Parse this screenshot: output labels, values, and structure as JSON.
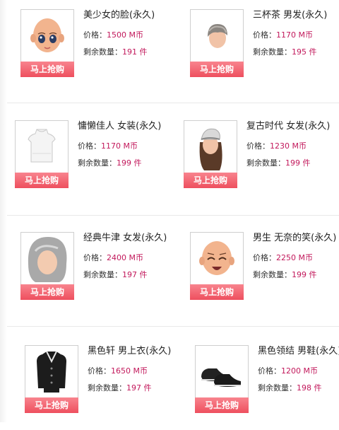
{
  "labels": {
    "price": "价格：",
    "stock": "剩余数量：",
    "buy_button": "马上抢购"
  },
  "items": [
    {
      "name": "美少女的脸(永久)",
      "price": "1500 M币",
      "stock": "191 件",
      "icon": "girl-face-icon"
    },
    {
      "name": "三杯茶 男发(永久)",
      "price": "1170 M币",
      "stock": "195 件",
      "icon": "male-hair-icon"
    },
    {
      "name": "慵懒佳人 女装(永久)",
      "price": "1170 M币",
      "stock": "199 件",
      "icon": "female-top-icon"
    },
    {
      "name": "复古时代 女发(永久)",
      "price": "1230 M币",
      "stock": "199 件",
      "icon": "retro-female-hair-icon"
    },
    {
      "name": "经典牛津 女发(永久)",
      "price": "2400 M币",
      "stock": "197 件",
      "icon": "oxford-female-hair-icon"
    },
    {
      "name": "男生 无奈的笑(永久)",
      "price": "2250 M币",
      "stock": "199 件",
      "icon": "laughing-face-icon"
    },
    {
      "name": "黑色轩 男上衣(永久)",
      "price": "1650 M币",
      "stock": "197 件",
      "icon": "black-coat-icon"
    },
    {
      "name": "黑色领结 男鞋(永久)",
      "price": "1200 M币",
      "stock": "198 件",
      "icon": "black-shoes-icon"
    }
  ]
}
